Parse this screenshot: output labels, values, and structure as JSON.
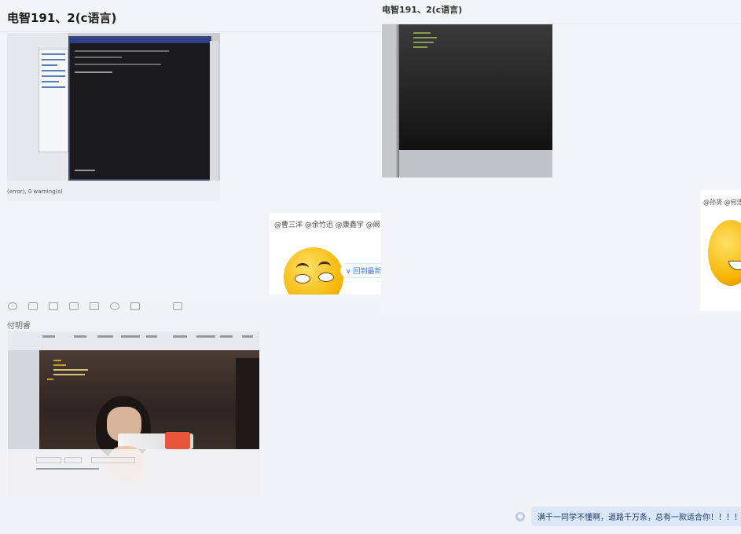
{
  "left_pane": {
    "title": "电智191、2(c语言)",
    "photo1_caption_fragment": "(error), 0 warning(s)",
    "emoji_tags": "@曹三洋 @余竹迅 @康鑫宇 @阙",
    "emoji_pill": "∨ 回到最新位置"
  },
  "right_pane": {
    "title": "电智191、2(c语言)",
    "emoji_tags": "@孙贤 @何浩然 @"
  },
  "bottom_pane": {
    "sender_name": "付明睿",
    "message": "满千一同学不懂啊，道路千万条，总有一款适合你！！！！"
  },
  "icons": {
    "toolbar": [
      "emoji-icon",
      "scissors-icon",
      "folder-icon",
      "image-icon",
      "screenshot-icon",
      "clock-icon",
      "more-icon",
      "send-icon"
    ]
  },
  "colors": {
    "background": "#f1f3f6",
    "bubble": "#dbe8fb",
    "emoji_yellow": "#f5b400"
  }
}
